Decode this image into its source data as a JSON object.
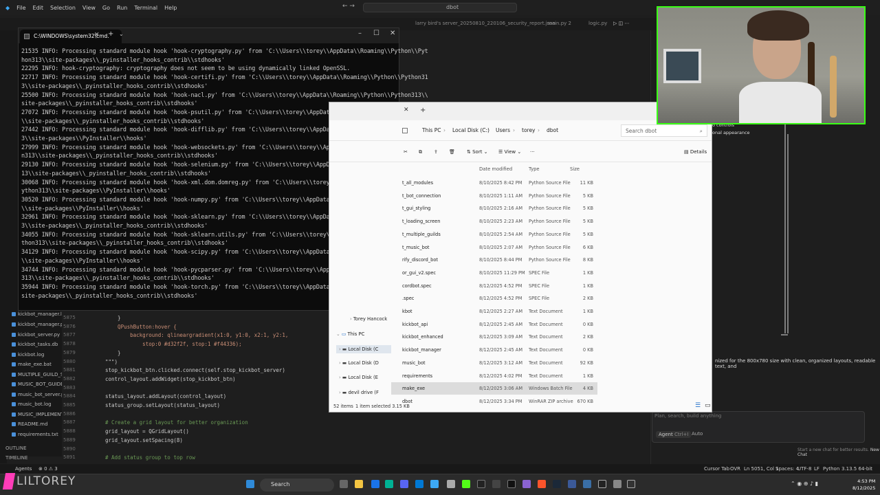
{
  "vscode": {
    "menu": [
      "File",
      "Edit",
      "Selection",
      "View",
      "Go",
      "Run",
      "Terminal",
      "Help"
    ],
    "search": "dbot",
    "tabs": [
      "larry bird's server_20250810_220106_security_report.json",
      "main.py 2",
      "logic.py"
    ],
    "sidebar_items": [
      "kickbot_manager.log",
      "kickbot_manager.py",
      "kickbot_server.py",
      "kickbot_tasks.db",
      "kickbot.log",
      "make_exe.bat",
      "MULTIPLE_GUILD_SU...",
      "MUSIC_BOT_GUIDE.md",
      "music_bot_server.py",
      "music_bot.log",
      "MUSIC_IMPLEMENTA...",
      "README.md",
      "requirements.txt"
    ],
    "outline": "OUTLINE",
    "timeline": "TIMELINE",
    "line_numbers": [
      "5875",
      "5876",
      "5877",
      "5878",
      "5879",
      "5880",
      "5881",
      "5882",
      "5883",
      "5884",
      "5885",
      "5886",
      "5887",
      "5888",
      "5889",
      "5890",
      "5891"
    ],
    "code_lines": [
      "    }",
      "    QPushButton:hover {",
      "        background: qlineargradient(x1:0, y1:0, x2:1, y2:1,",
      "            stop:0 #d32f2f, stop:1 #f44336);",
      "    }",
      "\"\"\")",
      "stop_kickbot_btn.clicked.connect(self.stop_kickbot_server)",
      "control_layout.addWidget(stop_kickbot_btn)",
      "",
      "status_layout.addLayout(control_layout)",
      "status_group.setLayout(status_layout)",
      "",
      "# Create a grid layout for better organization",
      "grid_layout = QGridLayout()",
      "grid_layout.setSpacing(8)",
      "",
      "# Add status group to top row"
    ],
    "status_left": [
      "Agents",
      "⊗ 0 ⚠ 3"
    ],
    "status_right": [
      "Cursor Tab",
      "OVR",
      "Ln 5051, Col 1",
      "Spaces: 4",
      "UTF-8",
      "LF",
      "Python",
      "3.13.5 64-bit"
    ],
    "chat_text": "nized for the 800x780 size with clean, organized layouts, readable text, and",
    "chat_placeholder": "Plan, search, build anything",
    "chat_agent": "Agent",
    "chat_agent_key": "Ctrl+I",
    "chat_auto": "Auto",
    "chat_footer": "Start a new chat for better results.",
    "chat_new": "New Chat",
    "right_pane_lines": [
      "o controls",
      "onal appearance"
    ]
  },
  "cmd": {
    "title": "C:\\WINDOWS\\system32\\cmd.",
    "lines": [
      "21535 INFO: Processing standard module hook 'hook-cryptography.py' from 'C:\\\\Users\\\\torey\\\\AppData\\\\Roaming\\\\Python\\\\Pyt",
      "hon313\\\\site-packages\\\\_pyinstaller_hooks_contrib\\\\stdhooks'",
      "22295 INFO: hook-cryptography: cryptography does not seem to be using dynamically linked OpenSSL.",
      "22717 INFO: Processing standard module hook 'hook-certifi.py' from 'C:\\\\Users\\\\torey\\\\AppData\\\\Roaming\\\\Python\\\\Python31",
      "3\\\\site-packages\\\\_pyinstaller_hooks_contrib\\\\stdhooks'",
      "25500 INFO: Processing standard module hook 'hook-nacl.py' from 'C:\\\\Users\\\\torey\\\\AppData\\\\Roaming\\\\Python\\\\Python313\\\\",
      "site-packages\\\\_pyinstaller_hooks_contrib\\\\stdhooks'",
      "27072 INFO: Processing standard module hook 'hook-psutil.py' from 'C:\\\\Users\\\\torey\\\\AppData\\\\Roaming\\\\Python\\\\Python313",
      "\\\\site-packages\\\\_pyinstaller_hooks_contrib\\\\stdhooks'",
      "27442 INFO: Processing standard module hook 'hook-difflib.py' from 'C:\\\\Users\\\\torey\\\\AppData\\\\Roaming\\\\Python\\\\Python31",
      "3\\\\site-packages\\\\PyInstaller\\\\hooks'",
      "27999 INFO: Processing standard module hook 'hook-websockets.py' from 'C:\\\\Users\\\\torey\\\\AppData\\\\Roaming\\\\Python\\\\Pytho",
      "n313\\\\site-packages\\\\_pyinstaller_hooks_contrib\\\\stdhooks'",
      "29130 INFO: Processing standard module hook 'hook-selenium.py' from 'C:\\\\Users\\\\torey\\\\AppData\\\\Roaming\\\\Python\\\\Python3",
      "13\\\\site-packages\\\\_pyinstaller_hooks_contrib\\\\stdhooks'",
      "30068 INFO: Processing standard module hook 'hook-xml.dom.domreg.py' from 'C:\\\\Users\\\\torey\\\\AppData\\\\Roaming\\\\Python\\\\P",
      "ython313\\\\site-packages\\\\PyInstaller\\\\hooks'",
      "30520 INFO: Processing standard module hook 'hook-numpy.py' from 'C:\\\\Users\\\\torey\\\\AppData\\\\Roaming\\\\Python\\\\Python313",
      "\\\\site-packages\\\\PyInstaller\\\\hooks'",
      "32961 INFO: Processing standard module hook 'hook-sklearn.py' from 'C:\\\\Users\\\\torey\\\\AppData\\\\Roaming\\\\Python\\\\Python31",
      "3\\\\site-packages\\\\_pyinstaller_hooks_contrib\\\\stdhooks'",
      "34055 INFO: Processing standard module hook 'hook-sklearn.utils.py' from 'C:\\\\Users\\\\torey\\\\AppData\\\\Roaming\\\\Python\\\\Py",
      "thon313\\\\site-packages\\\\_pyinstaller_hooks_contrib\\\\stdhooks'",
      "34129 INFO: Processing standard module hook 'hook-scipy.py' from 'C:\\\\Users\\\\torey\\\\AppData\\\\Roaming\\\\Python\\\\Python313",
      "\\\\site-packages\\\\PyInstaller\\\\hooks'",
      "34744 INFO: Processing standard module hook 'hook-pycparser.py' from 'C:\\\\Users\\\\torey\\\\AppData\\\\Roaming\\\\Python\\\\Python",
      "313\\\\site-packages\\\\_pyinstaller_hooks_contrib\\\\stdhooks'",
      "35944 INFO: Processing standard module hook 'hook-torch.py' from 'C:\\\\Users\\\\torey\\\\AppData\\\\Roaming\\\\Python\\\\Python313\\\\",
      "site-packages\\\\_pyinstaller_hooks_contrib\\\\stdhooks'"
    ]
  },
  "explorer": {
    "breadcrumb": [
      "This PC",
      "Local Disk (C:)",
      "Users",
      "torey",
      "dbot"
    ],
    "search_placeholder": "Search dbot",
    "toolbar": {
      "sort": "Sort",
      "view": "View",
      "more": "···",
      "details": "Details"
    },
    "columns": {
      "date": "Date modified",
      "type": "Type",
      "size": "Size"
    },
    "nav": [
      "Torey Hancock",
      "This PC",
      "Local Disk (C",
      "Local Disk (D",
      "Local Disk (E",
      "devil drive (F"
    ],
    "files": [
      {
        "name": "t_all_modules",
        "date": "8/10/2025 8:42 PM",
        "type": "Python Source File",
        "size": "11 KB"
      },
      {
        "name": "t_bot_connection",
        "date": "8/10/2025 1:11 AM",
        "type": "Python Source File",
        "size": "5 KB"
      },
      {
        "name": "t_gui_styling",
        "date": "8/10/2025 2:16 AM",
        "type": "Python Source File",
        "size": "5 KB"
      },
      {
        "name": "t_loading_screen",
        "date": "8/10/2025 2:23 AM",
        "type": "Python Source File",
        "size": "5 KB"
      },
      {
        "name": "t_multiple_guilds",
        "date": "8/10/2025 2:54 AM",
        "type": "Python Source File",
        "size": "5 KB"
      },
      {
        "name": "t_music_bot",
        "date": "8/10/2025 2:07 AM",
        "type": "Python Source File",
        "size": "6 KB"
      },
      {
        "name": "rify_discord_bot",
        "date": "8/10/2025 8:44 PM",
        "type": "Python Source File",
        "size": "8 KB"
      },
      {
        "name": "or_gui_v2.spec",
        "date": "8/10/2025 11:29 PM",
        "type": "SPEC File",
        "size": "1 KB"
      },
      {
        "name": "cordbot.spec",
        "date": "8/12/2025 4:52 PM",
        "type": "SPEC File",
        "size": "1 KB"
      },
      {
        "name": ".spec",
        "date": "8/12/2025 4:52 PM",
        "type": "SPEC File",
        "size": "2 KB"
      },
      {
        "name": "kbot",
        "date": "8/12/2025 2:27 AM",
        "type": "Text Document",
        "size": "1 KB"
      },
      {
        "name": "kickbot_api",
        "date": "8/12/2025 2:45 AM",
        "type": "Text Document",
        "size": "0 KB"
      },
      {
        "name": "kickbot_enhanced",
        "date": "8/12/2025 3:09 AM",
        "type": "Text Document",
        "size": "2 KB"
      },
      {
        "name": "kickbot_manager",
        "date": "8/12/2025 2:45 AM",
        "type": "Text Document",
        "size": "0 KB"
      },
      {
        "name": "music_bot",
        "date": "8/12/2025 3:12 AM",
        "type": "Text Document",
        "size": "92 KB"
      },
      {
        "name": "requirements",
        "date": "8/12/2025 4:02 PM",
        "type": "Text Document",
        "size": "1 KB"
      },
      {
        "name": "make_exe",
        "date": "8/12/2025 3:06 AM",
        "type": "Windows Batch File",
        "size": "4 KB",
        "selected": true
      },
      {
        "name": "dbot",
        "date": "8/12/2025 3:34 PM",
        "type": "WinRAR ZIP archive",
        "size": "670 KB"
      }
    ],
    "status": {
      "count": "52 items",
      "selected": "1 item selected  3.15 KB"
    }
  },
  "taskbar": {
    "search": "Search",
    "time": "4:53 PM",
    "date": "8/12/2025",
    "watermark": "LILTOREY"
  },
  "colors": {
    "cam_border": "#39ff14",
    "accent": "#0078d4"
  }
}
